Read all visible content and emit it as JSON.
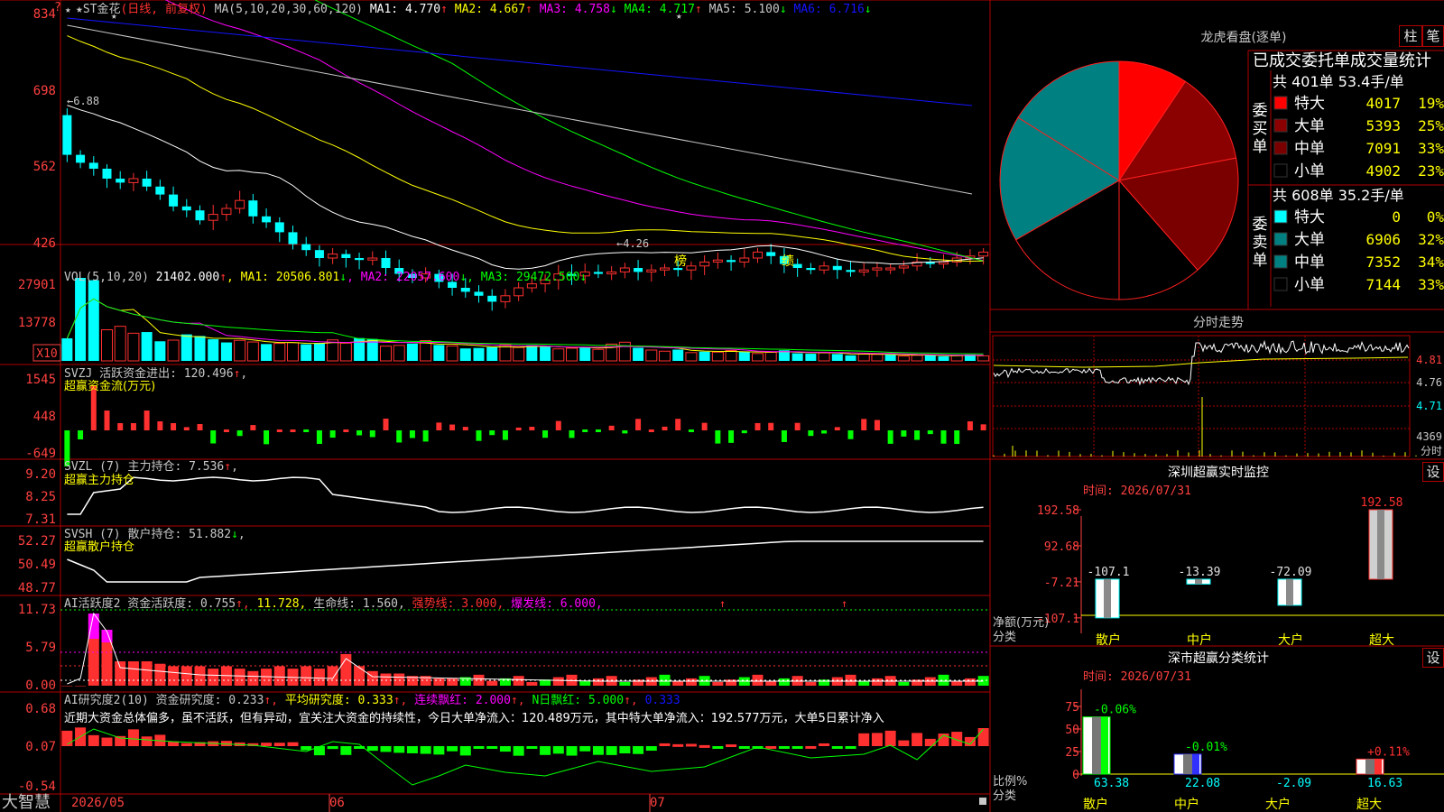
{
  "colors": {
    "up": "#ff3030",
    "down": "#00ffff",
    "grid": "#b00000",
    "axis_text": "#ff4040",
    "ma1": "#ffffff",
    "ma2": "#ffff00",
    "ma3": "#ff00ff",
    "ma4": "#00ff00",
    "ma5": "#c8c8c8",
    "ma6": "#1414ff",
    "text": "#c8c8c8",
    "yellow": "#ffff00",
    "cyan": "#00ffff",
    "magenta": "#ff00ff"
  },
  "brand": "大智慧",
  "main_chart": {
    "corner_mark": "?",
    "title": "★ST金花",
    "period": "(日线, 前复权)",
    "ma_header": "MA(5,10,20,30,60,120)",
    "ma_values": [
      {
        "label": "MA1: 4.770",
        "arrow": "↑",
        "color": "#ffffff"
      },
      {
        "label": "MA2: 4.667",
        "arrow": "↑",
        "color": "#ffff00"
      },
      {
        "label": "MA3: 4.758",
        "arrow": "↓",
        "color": "#ff00ff"
      },
      {
        "label": "MA4: 4.717",
        "arrow": "↑",
        "color": "#00ff00"
      },
      {
        "label": "MA5: 5.100",
        "arrow": "↓",
        "color": "#c8c8c8"
      },
      {
        "label": "MA6: 6.716",
        "arrow": "↓",
        "color": "#1414ff"
      }
    ],
    "y_ticks": [
      "834",
      "698",
      "562",
      "426"
    ],
    "max_label": "←6.88",
    "min_label": "←4.26",
    "markers": [
      "榜",
      "绩"
    ]
  },
  "vol_panel": {
    "header": "VOL(5,10,20)",
    "value": "21402.000",
    "items": [
      {
        "label": "MA1: 20506.801",
        "arrow": "↓",
        "color": "#ffff00"
      },
      {
        "label": "MA2: 22057.600",
        "arrow": "↓",
        "color": "#ff00ff"
      },
      {
        "label": "MA3: 29472.500",
        "arrow": "↓",
        "color": "#00ff00"
      }
    ],
    "y_ticks": [
      "27901",
      "13778"
    ],
    "unit": "X10",
    "values": [
      9800,
      36000,
      35000,
      13500,
      15000,
      12000,
      12500,
      8500,
      9000,
      11500,
      10800,
      9400,
      8000,
      8900,
      8200,
      7300,
      7600,
      7900,
      7200,
      7800,
      9100,
      7700,
      9900,
      9500,
      6400,
      6700,
      7500,
      8800,
      6900,
      6500,
      5400,
      5600,
      6000,
      7000,
      5800,
      6800,
      6100,
      5200,
      5500,
      5900,
      5000,
      7300,
      8100,
      5700,
      4700,
      4200,
      4900,
      3600,
      4000,
      3800,
      4500,
      3900,
      3200,
      3700,
      4600,
      3300,
      3100,
      3500,
      3000,
      2400,
      2900,
      2800,
      2700,
      2100,
      2400,
      2600,
      2000,
      2300,
      2800,
      2200
    ],
    "dirs": [
      0,
      0,
      0,
      1,
      1,
      1,
      0,
      0,
      1,
      0,
      0,
      0,
      0,
      1,
      1,
      0,
      1,
      1,
      0,
      0,
      1,
      1,
      0,
      0,
      1,
      1,
      0,
      1,
      0,
      1,
      0,
      0,
      0,
      1,
      1,
      0,
      0,
      1,
      1,
      0,
      1,
      1,
      1,
      0,
      1,
      1,
      0,
      1,
      0,
      1,
      1,
      0,
      1,
      1,
      0,
      0,
      0,
      1,
      0,
      0,
      1,
      1,
      0,
      1,
      1,
      0,
      0,
      1,
      0,
      1
    ]
  },
  "svzj_panel": {
    "header": "SVZJ  活跃资金进出: 120.496",
    "arrow": "↑",
    "subtitle": "超赢资金流(万元)",
    "y_ticks": [
      "1545",
      "448",
      "-649"
    ]
  },
  "svzl_panel": {
    "header": "SVZL (7) 主力持仓: 7.536",
    "arrow": "↑",
    "subtitle": "超赢主力持仓",
    "y_ticks": [
      "9.20",
      "8.25",
      "7.31"
    ]
  },
  "svsh_panel": {
    "header": "SVSH (7) 散户持仓: 51.882",
    "arrow": "↓",
    "subtitle": "超赢散户持仓",
    "y_ticks": [
      "52.27",
      "50.49",
      "48.77"
    ]
  },
  "ai_active_panel": {
    "header": "AI活跃度2 资金活跃度: 0.755",
    "items": [
      {
        "label": "11.728,",
        "color": "#ffff00"
      },
      {
        "label": "生命线: 1.560,",
        "color": "#c8c8c8"
      },
      {
        "label": "强势线: 3.000,",
        "color": "#ff3030"
      },
      {
        "label": "爆发线: 6.000,",
        "color": "#ff00ff"
      }
    ],
    "y_ticks": [
      "11.73",
      "5.79",
      "0.00"
    ]
  },
  "ai_research_panel": {
    "header": "AI研究度2(10) 资金研究度: 0.233",
    "items": [
      {
        "label": "平均研究度: 0.333",
        "color": "#ffff00"
      },
      {
        "label": "连续飘红: 2.000",
        "color": "#ff00ff"
      },
      {
        "label": "N日飘红: 5.000",
        "color": "#00ff00"
      },
      {
        "label": "0.333",
        "color": "#1414ff"
      }
    ],
    "commentary": "近期大资金总体偏多，虽不活跃，但有异动，宜关注大资金的持续性，今日大单净流入：120.489万元，其中特大单净流入：192.577万元，大单5日累计净入",
    "y_ticks": [
      "0.68",
      "0.07",
      "-0.54"
    ]
  },
  "x_axis": {
    "labels": [
      "2026/05",
      "06",
      "07"
    ]
  },
  "right_panel": {
    "tabs": [
      "柱",
      "笔"
    ],
    "pie_title": "龙虎看盘(逐单)",
    "stats_title": "已成交委托单成交量统计",
    "buy": {
      "side_label": "委买单",
      "summary": "共 401单 53.4手/单",
      "rows": [
        {
          "label": "特大",
          "value": "4017",
          "pct": "19%",
          "color": "#ff0000"
        },
        {
          "label": "大单",
          "value": "5393",
          "pct": "25%",
          "color": "#8b0000"
        },
        {
          "label": "中单",
          "value": "7091",
          "pct": "33%",
          "color": "#7a0000"
        },
        {
          "label": "小单",
          "value": "4902",
          "pct": "23%",
          "color": "#000000"
        }
      ]
    },
    "sell": {
      "side_label": "委卖单",
      "summary": "共 608单 35.2手/单",
      "rows": [
        {
          "label": "特大",
          "value": "0",
          "pct": "0%",
          "color": "#00ffff"
        },
        {
          "label": "大单",
          "value": "6906",
          "pct": "32%",
          "color": "#008080"
        },
        {
          "label": "中单",
          "value": "7352",
          "pct": "34%",
          "color": "#008080"
        },
        {
          "label": "小单",
          "value": "7144",
          "pct": "33%",
          "color": "#000000"
        }
      ]
    },
    "minute_title": "分时走势",
    "minute_y_ticks": [
      "4.81",
      "4.76",
      "4.71"
    ],
    "minute_vol_label": "4369",
    "minute_unit": "分时",
    "realtime": {
      "title": "深圳超赢实时监控",
      "settings": "设",
      "time": "时间: 2026/07/31",
      "y_ticks": [
        "192.58",
        "92.68",
        "-7.21",
        "-107.1"
      ],
      "axis_label": "净额(万元)",
      "cat_label": "分类",
      "categories": [
        "散户",
        "中户",
        "大户",
        "超大"
      ],
      "values": [
        -107.1,
        -13.39,
        -72.09,
        192.58
      ],
      "value_labels": [
        "-107.1",
        "-13.39",
        "-72.09",
        "192.58"
      ]
    },
    "classify": {
      "title": "深市超赢分类统计",
      "settings": "设",
      "time": "时间: 2026/07/31",
      "y_ticks": [
        "75",
        "50",
        "25",
        "0"
      ],
      "axis_label": "比例%",
      "cat_label": "分类",
      "categories": [
        "散户",
        "中户",
        "大户",
        "超大"
      ],
      "values": [
        63.38,
        22.08,
        -2.09,
        16.63
      ],
      "value_labels": [
        "63.38",
        "22.08",
        "-2.09",
        "16.63"
      ],
      "changes": [
        "-0.06%",
        "-0.01%",
        "",
        "+0.11%"
      ]
    }
  }
}
